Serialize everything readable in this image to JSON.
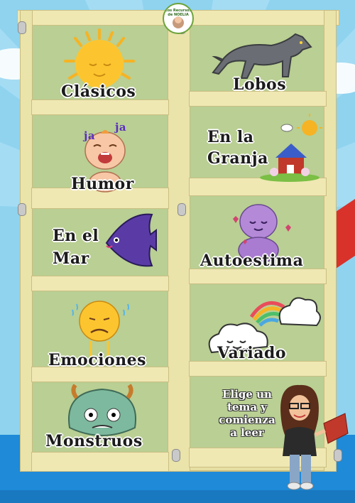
{
  "logo": {
    "text": "Los Recursos de NOELIA",
    "icon": "logo-badge-icon"
  },
  "categories": {
    "clasicos": {
      "label": "Clásicos",
      "icon": "sun-icon"
    },
    "lobos": {
      "label": "Lobos",
      "icon": "wolf-icon"
    },
    "humor": {
      "label": "Humor",
      "icon": "laughing-baby-icon",
      "laugh_left": "ja",
      "laugh_right": "ja"
    },
    "granja": {
      "label_line1": "En la",
      "label_line2": "Granja",
      "icon": "farm-icon"
    },
    "mar": {
      "label_line1": "En el",
      "label_line2": "Mar",
      "icon": "fish-icon"
    },
    "autoestima": {
      "label": "Autoestima",
      "icon": "self-hug-icon"
    },
    "emociones": {
      "label": "Emociones",
      "icon": "sad-face-icon"
    },
    "variado": {
      "label": "Variado",
      "icon": "cloud-rainbow-icon"
    },
    "monstruos": {
      "label": "Monstruos",
      "icon": "monster-icon"
    }
  },
  "call_to_action": {
    "line1": "Elige un",
    "line2": "tema y",
    "line3": "comienza",
    "line4": "a leer"
  },
  "colors": {
    "sky": "#8fd3ef",
    "wood": "#e7dfa3",
    "shelf_back": "#b9cf93",
    "floor": "#1e8ad8"
  }
}
